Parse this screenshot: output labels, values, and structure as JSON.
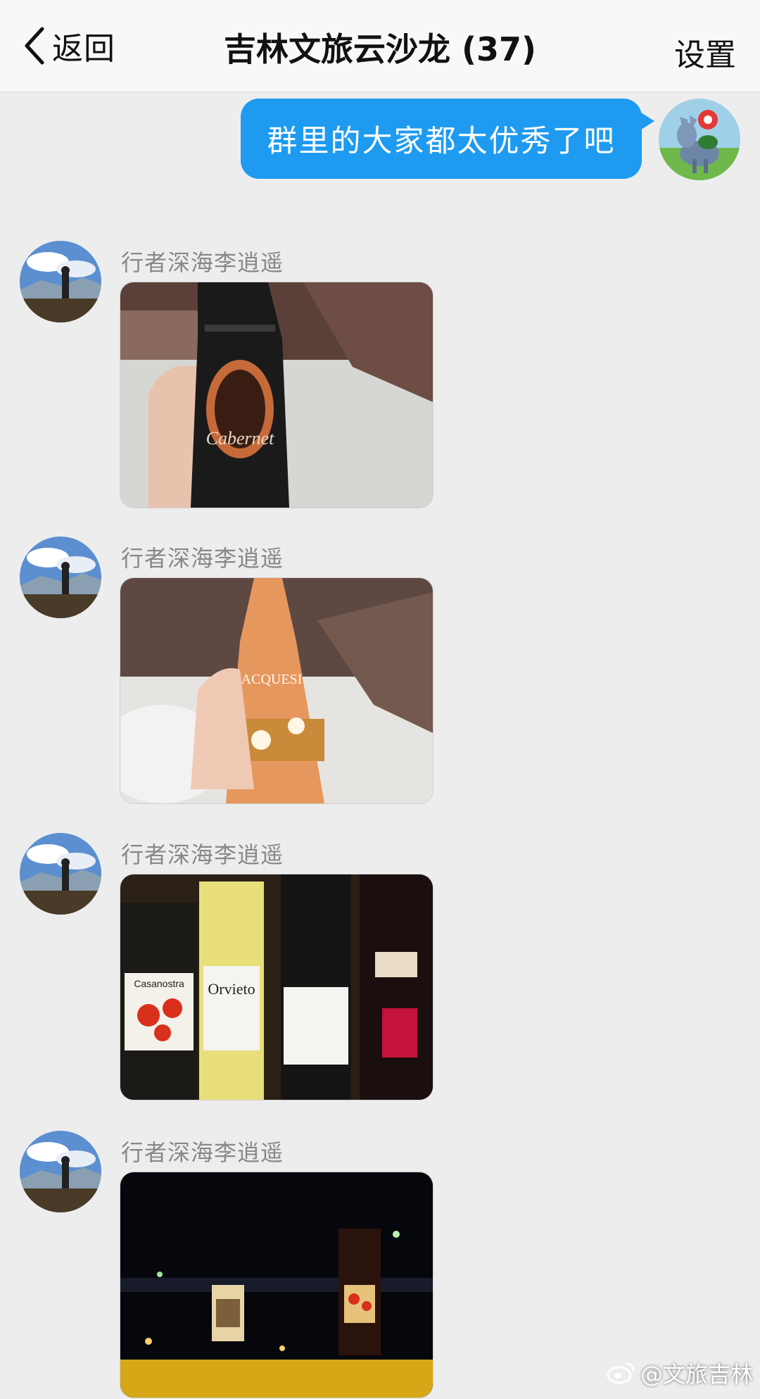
{
  "navbar": {
    "back_label": "返回",
    "title": "吉林文旅云沙龙 (37)",
    "settings_label": "设置"
  },
  "outgoing_message": {
    "text": "群里的大家都太优秀了吧"
  },
  "messages": [
    {
      "sender": "行者深海李逍遥",
      "photo": "phone-photo-cabernet-wine-bottle",
      "bottle_label": "Cabernet"
    },
    {
      "sender": "行者深海李逍遥",
      "photo": "phone-photo-rose-wine-bottle",
      "bottle_label": "ACQUESI"
    },
    {
      "sender": "行者深海李逍遥",
      "photo": "phone-photo-wine-shelf",
      "bottle_label_1": "Casanostra",
      "bottle_label_2": "Orvieto"
    },
    {
      "sender": "行者深海李逍遥",
      "photo": "phone-photo-night-table-wine"
    }
  ],
  "watermark": {
    "text": "@文旅吉林"
  },
  "colors": {
    "bubble": "#1e9bf0",
    "background": "#ededed",
    "navbar": "#f8f8f8"
  }
}
